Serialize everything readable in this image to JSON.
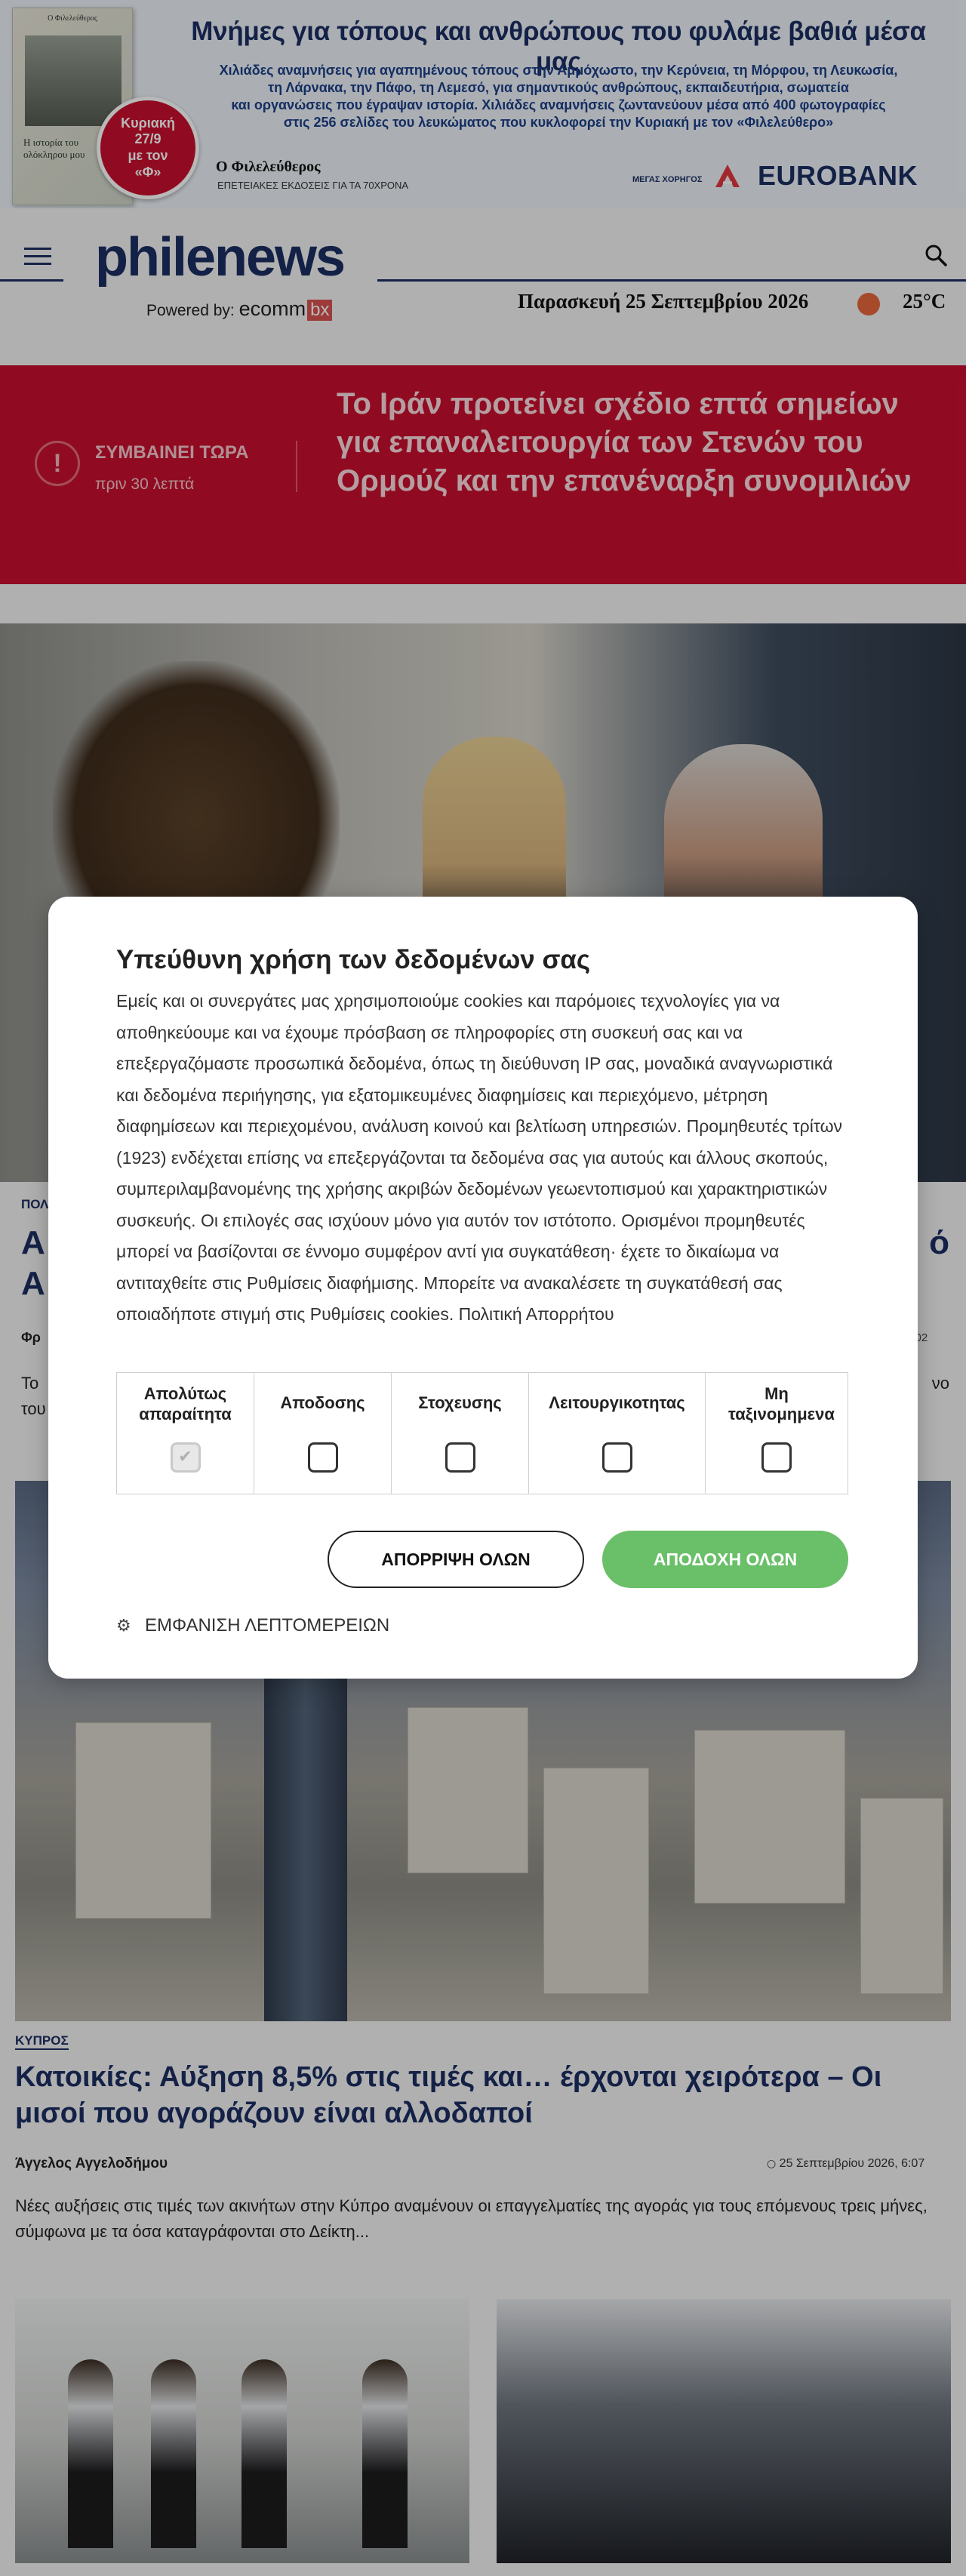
{
  "promo": {
    "book_publisher": "Ο Φιλελεύθερος",
    "book_title": "Η ιστορία του ολόκληρου μου",
    "badge_line1": "Κυριακή",
    "badge_line2": "27/9",
    "badge_line3": "με τον",
    "badge_line4": "«Φ»",
    "title": "Μνήμες για τόπους και ανθρώπους που φυλάμε βαθιά μέσα μας",
    "subtitle_lines": [
      "Χιλιάδες αναμνήσεις για αγαπημένους τόπους στην Αμμόχωστο, την Κερύνεια, τη Μόρφου, τη Λευκωσία,",
      "τη Λάρνακα, την Πάφο, τη Λεμεσό, για σημαντικούς ανθρώπους, εκπαιδευτήρια, σωματεία",
      "και οργανώσεις που έγραψαν ιστορία. Χιλιάδες αναμνήσεις ζωντανεύουν μέσα από 400 φωτογραφίες",
      "στις 256 σελίδες του λευκώματος που κυκλοφορεί την Κυριακή με τον «Φιλελεύθερο»"
    ],
    "publisher_logo": "Ο Φιλελεύθερος",
    "publisher_tagline": "ΕΠΕΤΕΙΑΚΕΣ ΕΚΔΟΣΕΙΣ ΓΙΑ ΤΑ 70ΧΡΟΝΑ",
    "sponsor_label": "ΜΕΓΑΣ ΧΟΡΗΓΟΣ",
    "sponsor_name": "EUROBANK",
    "sponsor_color": "#e2383f"
  },
  "header": {
    "logo": "philenews",
    "powered_by": "Powered by:",
    "partner_a": "ecomm",
    "partner_b": "bx",
    "date": "Παρασκευή 25 Σεπτεμβρίου 2026",
    "temperature": "25°C",
    "icons": [
      "menu-icon",
      "search-icon",
      "weather-icon"
    ],
    "brand_color": "#1c2f63"
  },
  "breaking": {
    "label": "ΣΥΜΒΑΙΝΕΙ ΤΩΡΑ",
    "time": "πριν 30 λεπτά",
    "title": "Το Ιράν προτείνει σχέδιο επτά σημείων για επαναλειτουργία των Στενών του Ορμούζ και την επανέναρξη συνομιλιών",
    "color": "#c8102e"
  },
  "article1": {
    "category": "ΠΟΛ",
    "title_start": "Α",
    "title_end": "ό",
    "title_line2": "Α",
    "author": "Φρ",
    "time": "6:02",
    "lead_start": "Το",
    "lead_end": "νο",
    "lead_line2": "του"
  },
  "article2": {
    "category": "ΚΥΠΡΟΣ",
    "title": "Κατοικίες: Αύξηση 8,5% στις τιμές και… έρχονται χειρότερα – Οι μισοί που αγοράζουν είναι αλλοδαποί",
    "author": "Άγγελος Αγγελοδήμου",
    "time": "25 Σεπτεμβρίου 2026, 6:07",
    "lead": "Νέες αυξήσεις στις τιμές των ακινήτων στην Κύπρο αναμένουν οι επαγγελματίες της αγοράς για τους επόμενους τρεις μήνες, σύμφωνα με τα όσα καταγράφονται στο Δείκτη..."
  },
  "cookie_modal": {
    "title": "Υπεύθυνη χρήση των δεδομένων σας",
    "body": "Εμείς και οι συνεργάτες μας χρησιμοποιούμε cookies και παρόμοιες τεχνολογίες για να αποθηκεύουμε και να έχουμε πρόσβαση σε πληροφορίες στη συσκευή σας και να επεξεργαζόμαστε προσωπικά δεδομένα, όπως τη διεύθυνση IP σας, μοναδικά αναγνωριστικά και δεδομένα περιήγησης, για εξατομικευμένες διαφημίσεις και περιεχόμενο, μέτρηση διαφημίσεων και περιεχομένου, ανάλυση κοινού και βελτίωση υπηρεσιών. Προμηθευτές τρίτων (1923) ενδέχεται επίσης να επεξεργάζονται τα δεδομένα σας για αυτούς και άλλους σκοπούς, συμπεριλαμβανομένης της χρήσης ακριβών δεδομένων γεωεντοπισμού και χαρακτηριστικών συσκευής. Οι επιλογές σας ισχύουν μόνο για αυτόν τον ιστότοπο. Ορισμένοι προμηθευτές μπορεί να βασίζονται σε έννομο συμφέρον αντί για συγκατάθεση· έχετε το δικαίωμα να αντιταχθείτε στις Ρυθμίσεις διαφήμισης. Μπορείτε να ανακαλέσετε τη συγκατάθεσή σας οποιαδήποτε στιγμή στις Ρυθμίσεις cookies. Πολιτική Απορρήτου",
    "categories": [
      {
        "label": "Απολύτως απαραίτητα",
        "checked": true,
        "disabled": true
      },
      {
        "label": "Αποδοσης",
        "checked": false,
        "disabled": false
      },
      {
        "label": "Στοχευσης",
        "checked": false,
        "disabled": false
      },
      {
        "label": "Λειτουργικοτητας",
        "checked": false,
        "disabled": false
      },
      {
        "label": "Μη ταξινομημενα",
        "checked": false,
        "disabled": false
      }
    ],
    "reject_label": "ΑΠΟΡΡΙΨΗ ΟΛΩΝ",
    "accept_label": "ΑΠΟΔΟΧΗ ΟΛΩΝ",
    "details_label": "ΕΜΦΑΝΙΣΗ ΛΕΠΤΟΜΕΡΕΙΩΝ",
    "accept_color": "#6abf69"
  }
}
